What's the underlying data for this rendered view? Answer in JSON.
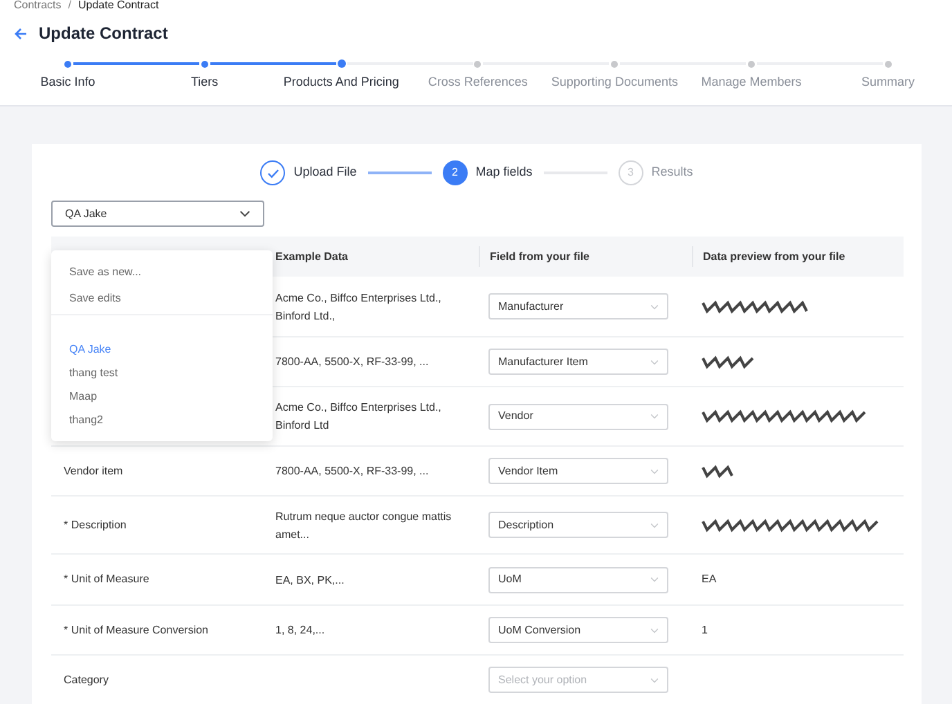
{
  "breadcrumb": [
    {
      "label": "Contracts",
      "current": false
    },
    {
      "label": "Update Contract",
      "current": true
    }
  ],
  "separator": "/",
  "title": "Update Contract",
  "steps": [
    {
      "label": "Basic Info",
      "kind": "done"
    },
    {
      "label": "Tiers",
      "kind": "done"
    },
    {
      "label": "Products And Pricing",
      "kind": "current"
    },
    {
      "label": "Cross References",
      "kind": "upcoming"
    },
    {
      "label": "Supporting Documents",
      "kind": "upcoming"
    },
    {
      "label": "Manage Members",
      "kind": "upcoming"
    },
    {
      "label": "Summary",
      "kind": "upcoming"
    }
  ],
  "import_steps": [
    {
      "label": "Upload File",
      "kind": "done"
    },
    {
      "number": "2",
      "label": "Map fields",
      "kind": "current"
    },
    {
      "number": "3",
      "label": "Results",
      "kind": "upcoming"
    }
  ],
  "preset_select": {
    "value": "QA Jake",
    "expanded": true
  },
  "preset_menu": {
    "actions": [
      "Save as new...",
      "Save edits"
    ],
    "presets": [
      {
        "label": "QA Jake",
        "selected": true
      },
      {
        "label": "thang test",
        "selected": false
      },
      {
        "label": "Maap",
        "selected": false
      },
      {
        "label": "thang2",
        "selected": false
      }
    ]
  },
  "table": {
    "columns": [
      "Example Data",
      "Field from your file",
      "Data preview from your file"
    ],
    "rows": [
      {
        "example": "Acme Co., Biffco Enterprises Ltd., Binford Ltd.,",
        "mapping": {
          "value": "Manufacturer"
        },
        "preview": {
          "kind": "redacted"
        }
      },
      {
        "example": "7800-AA, 5500-X, RF-33-99, ...",
        "mapping": {
          "value": "Manufacturer Item"
        },
        "preview": {
          "kind": "redacted"
        }
      },
      {
        "example": "Acme Co., Biffco Enterprises Ltd., Binford Ltd",
        "mapping": {
          "value": "Vendor"
        },
        "preview": {
          "kind": "redacted"
        }
      },
      {
        "field": "Vendor item",
        "example": "7800-AA, 5500-X, RF-33-99, ...",
        "mapping": {
          "value": "Vendor Item"
        },
        "preview": {
          "kind": "redacted"
        }
      },
      {
        "field": "* Description",
        "example": "Rutrum neque auctor congue mattis amet...",
        "mapping": {
          "value": "Description"
        },
        "preview": {
          "kind": "redacted"
        }
      },
      {
        "field": "* Unit of Measure",
        "example": "EA, BX, PK,...",
        "mapping": {
          "value": "UoM"
        },
        "preview": {
          "kind": "text",
          "text": "EA"
        }
      },
      {
        "field": "* Unit of Measure Conversion",
        "example": "1, 8, 24,...",
        "mapping": {
          "value": "UoM Conversion"
        },
        "preview": {
          "kind": "text",
          "text": "1"
        }
      },
      {
        "field": "Category",
        "mapping": {
          "placeholder": "Select your option"
        },
        "preview": {
          "kind": "none"
        }
      }
    ]
  }
}
